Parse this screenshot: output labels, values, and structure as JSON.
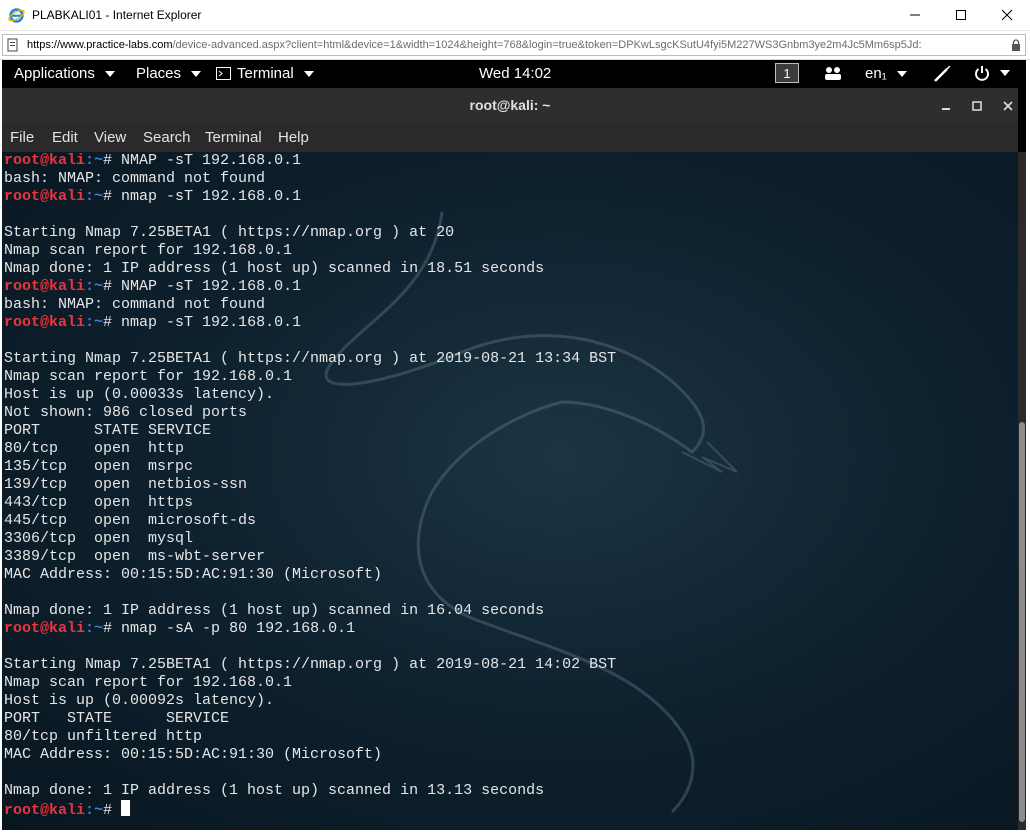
{
  "browser": {
    "title": "PLABKALI01 - Internet Explorer",
    "url_host": "https://www.practice-labs.com",
    "url_rest": "/device-advanced.aspx?client=html&device=1&width=1024&height=768&login=true&token=DPKwLsgcKSutU4fyi5M227WS3Gnbm3ye2m4Jc5Mm6sp5Jd:"
  },
  "panel": {
    "applications": "Applications",
    "places": "Places",
    "terminal": "Terminal",
    "clock": "Wed 14:02",
    "workspace": "1",
    "keyboard": "en₁"
  },
  "terminal": {
    "title": "root@kali: ~",
    "menu": [
      "File",
      "Edit",
      "View",
      "Search",
      "Terminal",
      "Help"
    ],
    "prompt_user": "root@kali",
    "prompt_path": ":~",
    "prompt_suffix": "# ",
    "lines": [
      {
        "type": "cmd",
        "text": "NMAP -sT 192.168.0.1"
      },
      {
        "type": "out",
        "text": "bash: NMAP: command not found"
      },
      {
        "type": "cmd",
        "text": "nmap -sT 192.168.0.1"
      },
      {
        "type": "out",
        "text": ""
      },
      {
        "type": "out",
        "text": "Starting Nmap 7.25BETA1 ( https://nmap.org ) at 20"
      },
      {
        "type": "out",
        "text": "Nmap scan report for 192.168.0.1"
      },
      {
        "type": "out",
        "text": "Nmap done: 1 IP address (1 host up) scanned in 18.51 seconds"
      },
      {
        "type": "cmd",
        "text": "NMAP -sT 192.168.0.1"
      },
      {
        "type": "out",
        "text": "bash: NMAP: command not found"
      },
      {
        "type": "cmd",
        "text": "nmap -sT 192.168.0.1"
      },
      {
        "type": "out",
        "text": ""
      },
      {
        "type": "out",
        "text": "Starting Nmap 7.25BETA1 ( https://nmap.org ) at 2019-08-21 13:34 BST"
      },
      {
        "type": "out",
        "text": "Nmap scan report for 192.168.0.1"
      },
      {
        "type": "out",
        "text": "Host is up (0.00033s latency)."
      },
      {
        "type": "out",
        "text": "Not shown: 986 closed ports"
      },
      {
        "type": "out",
        "text": "PORT      STATE SERVICE"
      },
      {
        "type": "out",
        "text": "80/tcp    open  http"
      },
      {
        "type": "out",
        "text": "135/tcp   open  msrpc"
      },
      {
        "type": "out",
        "text": "139/tcp   open  netbios-ssn"
      },
      {
        "type": "out",
        "text": "443/tcp   open  https"
      },
      {
        "type": "out",
        "text": "445/tcp   open  microsoft-ds"
      },
      {
        "type": "out",
        "text": "3306/tcp  open  mysql"
      },
      {
        "type": "out",
        "text": "3389/tcp  open  ms-wbt-server"
      },
      {
        "type": "out",
        "text": "MAC Address: 00:15:5D:AC:91:30 (Microsoft)"
      },
      {
        "type": "out",
        "text": ""
      },
      {
        "type": "out",
        "text": "Nmap done: 1 IP address (1 host up) scanned in 16.04 seconds"
      },
      {
        "type": "cmd",
        "text": "nmap -sA -p 80 192.168.0.1"
      },
      {
        "type": "out",
        "text": ""
      },
      {
        "type": "out",
        "text": "Starting Nmap 7.25BETA1 ( https://nmap.org ) at 2019-08-21 14:02 BST"
      },
      {
        "type": "out",
        "text": "Nmap scan report for 192.168.0.1"
      },
      {
        "type": "out",
        "text": "Host is up (0.00092s latency)."
      },
      {
        "type": "out",
        "text": "PORT   STATE      SERVICE"
      },
      {
        "type": "out",
        "text": "80/tcp unfiltered http"
      },
      {
        "type": "out",
        "text": "MAC Address: 00:15:5D:AC:91:30 (Microsoft)"
      },
      {
        "type": "out",
        "text": ""
      },
      {
        "type": "out",
        "text": "Nmap done: 1 IP address (1 host up) scanned in 13.13 seconds"
      },
      {
        "type": "cmd",
        "text": ""
      }
    ]
  }
}
